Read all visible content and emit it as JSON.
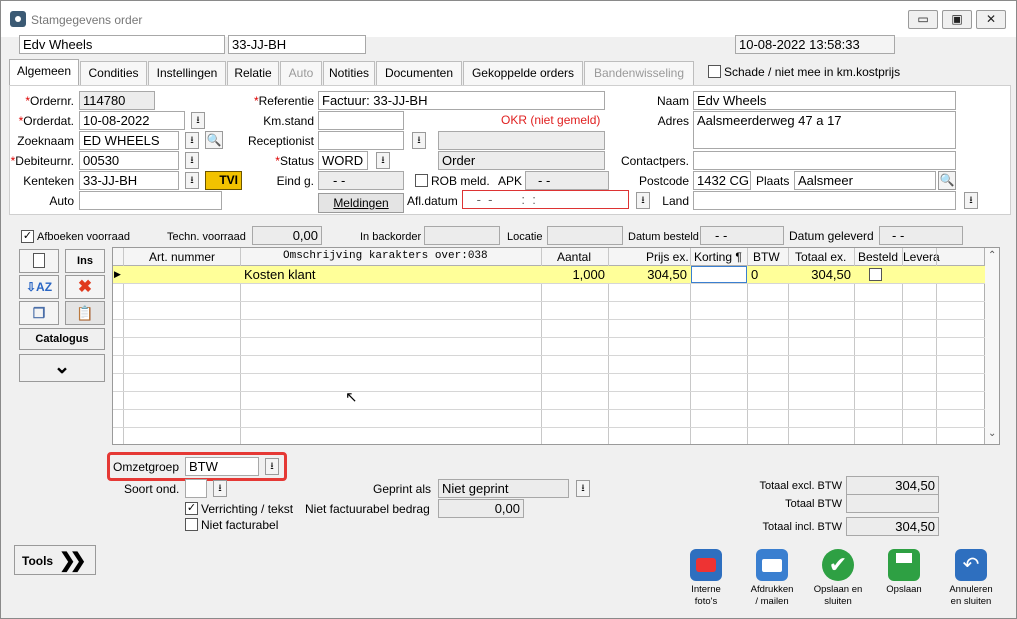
{
  "window": {
    "title": "Stamgegevens order",
    "min": "▭",
    "max": "▣",
    "close": "✕"
  },
  "top": {
    "name": "Edv Wheels",
    "plate": "33-JJ-BH",
    "datetime": "10-08-2022 13:58:33"
  },
  "tabs": [
    {
      "label": "Algemeen"
    },
    {
      "label": "Condities"
    },
    {
      "label": "Instellingen"
    },
    {
      "label": "Relatie"
    },
    {
      "label": "Auto"
    },
    {
      "label": "Notities"
    },
    {
      "label": "Documenten"
    },
    {
      "label": "Gekoppelde orders"
    },
    {
      "label": "Bandenwisseling"
    }
  ],
  "damage_checkbox": "Schade / niet mee in km.kostprijs",
  "left": {
    "ordernr_label": "Ordernr.",
    "ordernr": "114780",
    "orderdat_label": "Orderdat.",
    "orderdat": "10-08-2022",
    "zoeknaam_label": "Zoeknaam",
    "zoeknaam": "ED WHEELS",
    "debiteur_label": "Debiteurnr.",
    "debiteur": "00530",
    "kenteken_label": "Kenteken",
    "kenteken": "33-JJ-BH",
    "tvi": "TVI",
    "auto_label": "Auto",
    "auto": ""
  },
  "mid": {
    "referentie_label": "Referentie",
    "referentie": "Factuur: 33-JJ-BH",
    "kmstand_label": "Km.stand",
    "okr": "OKR (niet gemeld)",
    "receptionist_label": "Receptionist",
    "status_label": "Status",
    "status": "WORD",
    "status_desc": "Order",
    "eindg_label": "Eind g.",
    "eindg": " -  - ",
    "rob_label": "ROB meld.",
    "apk_label": "APK",
    "apk": " -  - ",
    "meldingen": "Meldingen",
    "afldatum_label": "Afl.datum",
    "afldatum": " -  -        :  : "
  },
  "right": {
    "naam_label": "Naam",
    "naam": "Edv Wheels",
    "adres_label": "Adres",
    "adres": "Aalsmeerderweg 47 a 17",
    "contact_label": "Contactpers.",
    "postcode_label": "Postcode",
    "postcode": "1432 CG",
    "plaats_label": "Plaats",
    "plaats": "Aalsmeer",
    "land_label": "Land"
  },
  "bar": {
    "afboeken": "Afboeken voorraad",
    "techn_label": "Techn. voorraad",
    "techn": "0,00",
    "backorder_label": "In backorder",
    "locatie_label": "Locatie",
    "besteld_label": "Datum besteld",
    "besteld": " -  - ",
    "geleverd_label": "Datum geleverd",
    "geleverd": " -  - "
  },
  "grid": {
    "headers": [
      "Art. nummer",
      "Omschrijving karakters over:038",
      "Aantal",
      "Prijs ex.",
      "Korting ¶",
      "BTW",
      "Totaal ex.",
      "Besteld",
      "Levera"
    ],
    "rows": [
      {
        "art": "",
        "oms": "Kosten klant",
        "aantal": "1,000",
        "prijs": "304,50",
        "korting": "",
        "btw": "0",
        "totaal": "304,50"
      }
    ]
  },
  "side": {
    "ins": "Ins",
    "catalogus": "Catalogus"
  },
  "bottom": {
    "omzetgroep_label": "Omzetgroep",
    "omzetgroep": "BTW",
    "soort_label": "Soort ond.",
    "verrichting": "Verrichting / tekst",
    "nietfact": "Niet facturabel",
    "geprint_label": "Geprint als",
    "geprint": "Niet geprint",
    "nietfactbedrag_label": "Niet factuurabel bedrag",
    "nietfactbedrag": "0,00",
    "excl_label": "Totaal excl. BTW",
    "excl": "304,50",
    "btw_label": "Totaal BTW",
    "btw": "",
    "incl_label": "Totaal incl. BTW",
    "incl": "304,50",
    "tools": "Tools"
  },
  "actions": [
    {
      "l1": "Interne",
      "l2": "foto's",
      "color": "#2e6fbf"
    },
    {
      "l1": "Afdrukken",
      "l2": "/ mailen",
      "color": "#3a7fd0"
    },
    {
      "l1": "Opslaan en",
      "l2": "sluiten",
      "color": "#2ea043"
    },
    {
      "l1": "Opslaan",
      "l2": "",
      "color": "#2ea043"
    },
    {
      "l1": "Annuleren",
      "l2": "en sluiten",
      "color": "#2e6fbf"
    }
  ],
  "colors": {
    "highlight_row": "#ffff99",
    "red_box": "#e53935",
    "tvi_bg": "#f2c200"
  }
}
